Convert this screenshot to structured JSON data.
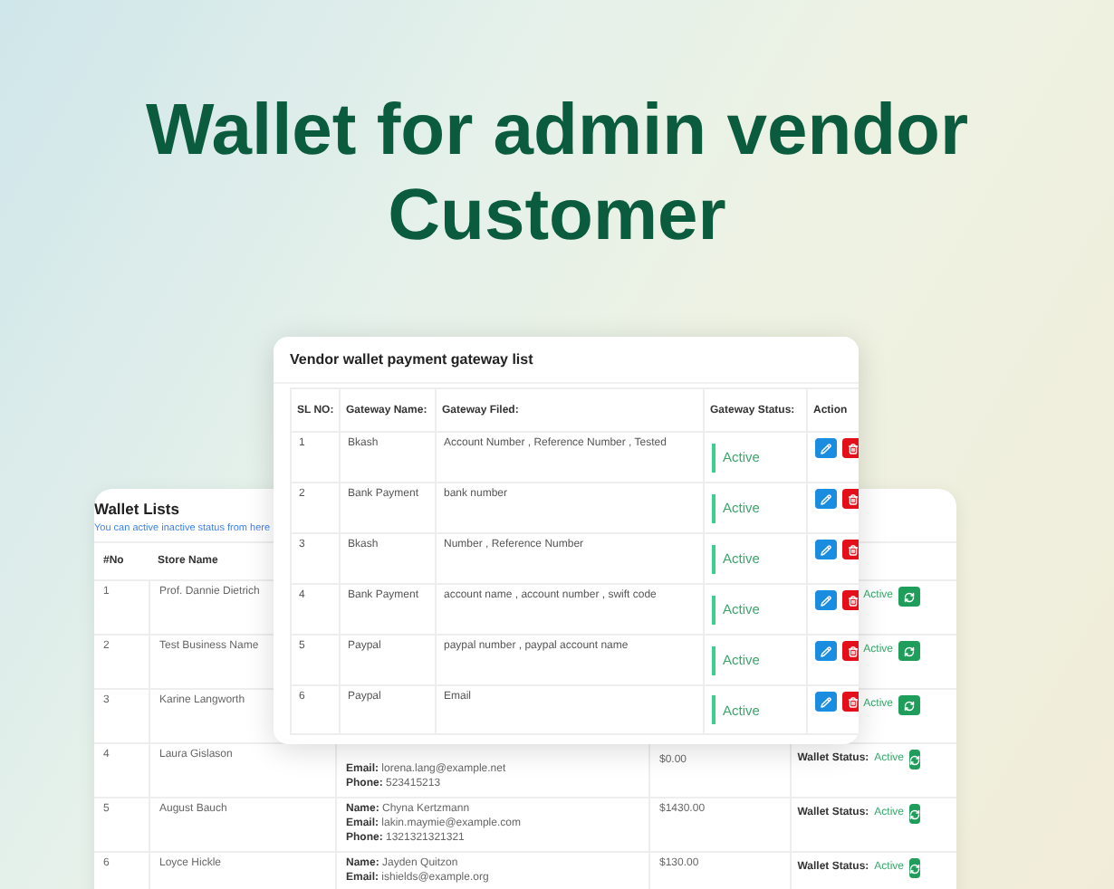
{
  "title": [
    "Wallet for admin vendor",
    "Customer"
  ],
  "wallet_list": {
    "title": "Wallet Lists",
    "subtitle": "You can active inactive status from here",
    "columns": [
      "#No",
      "Store Name"
    ],
    "rows": [
      {
        "no": "1",
        "store": "Prof. Dannie Dietrich",
        "details": [],
        "status": "Active"
      },
      {
        "no": "2",
        "store": "Test Business Name",
        "details": [],
        "status": "Active"
      },
      {
        "no": "3",
        "store": "Karine Langworth",
        "details": [],
        "status": "Active"
      },
      {
        "no": "4",
        "store": "Laura Gislason",
        "details": [
          "**Email:** lorena.lang@example.net",
          "**Phone:** 523415213"
        ],
        "amount": "$0.00",
        "status_label": "Wallet Status:",
        "status": "Active"
      },
      {
        "no": "5",
        "store": "August Bauch",
        "details": [
          "**Name:** Chyna Kertzmann",
          "**Email:** lakin.maymie@example.com",
          "**Phone:** 1321321321321"
        ],
        "amount": "$1430.00",
        "status_label": "Wallet Status:",
        "status": "Active"
      },
      {
        "no": "6",
        "store": "Loyce Hickle",
        "details": [
          "**Name:** Jayden Quitzon",
          "**Email:** ishields@example.org"
        ],
        "amount": "$130.00",
        "status_label": "Wallet Status:",
        "status": "Active"
      }
    ]
  },
  "gateway_list": {
    "title": "Vendor wallet payment gateway list",
    "columns": [
      "SL NO:",
      "Gateway Name:",
      "Gateway Filed:",
      "Gateway Status:",
      "Action"
    ],
    "rows": [
      {
        "sl": "1",
        "name": "Bkash",
        "fields": "Account Number , Reference Number , Tested",
        "status": "Active"
      },
      {
        "sl": "2",
        "name": "Bank Payment",
        "fields": "bank number",
        "status": "Active"
      },
      {
        "sl": "3",
        "name": "Bkash",
        "fields": "Number , Reference Number",
        "status": "Active"
      },
      {
        "sl": "4",
        "name": "Bank Payment",
        "fields": "account name , account number , swift code",
        "status": "Active"
      },
      {
        "sl": "5",
        "name": "Paypal",
        "fields": "paypal number , paypal account name",
        "status": "Active"
      },
      {
        "sl": "6",
        "name": "Paypal",
        "fields": "Email",
        "status": "Active"
      }
    ]
  }
}
